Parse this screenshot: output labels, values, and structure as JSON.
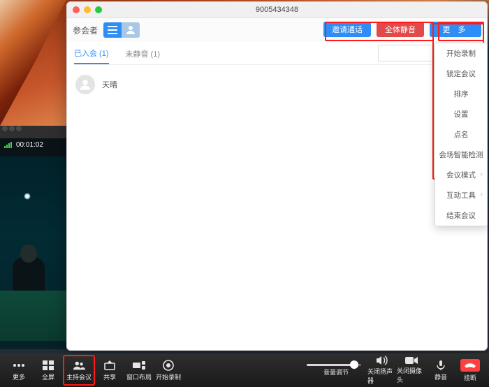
{
  "window": {
    "title": "9005434348"
  },
  "video": {
    "timer": "00:01:02"
  },
  "panel": {
    "participants_label": "参会者",
    "buttons": {
      "invite": "邀请通话",
      "mute_all": "全体静音",
      "more": "更 多"
    },
    "tabs": {
      "joined": "已入会 (1)",
      "unmuted": "未静音 (1)"
    },
    "participants": [
      {
        "name": "天晴"
      }
    ]
  },
  "more_menu": {
    "items": [
      {
        "label": "开始录制",
        "chev": false
      },
      {
        "label": "锁定会议",
        "chev": false
      },
      {
        "label": "排序",
        "chev": false
      },
      {
        "label": "设置",
        "chev": false
      },
      {
        "label": "点名",
        "chev": false
      },
      {
        "label": "会场智能检测",
        "chev": false
      },
      {
        "label": "会议模式",
        "chev": true
      },
      {
        "label": "互动工具",
        "chev": true
      },
      {
        "label": "结束会议",
        "chev": false
      }
    ]
  },
  "bottombar": {
    "more": "更多",
    "fullscreen": "全屏",
    "host": "主持会议",
    "share": "共享",
    "layout": "窗口布局",
    "record": "开始录制",
    "volume": "音量调节",
    "speaker": "关闭扬声器",
    "camera": "关闭摄像头",
    "mute": "静音",
    "hangup": "挂断"
  }
}
